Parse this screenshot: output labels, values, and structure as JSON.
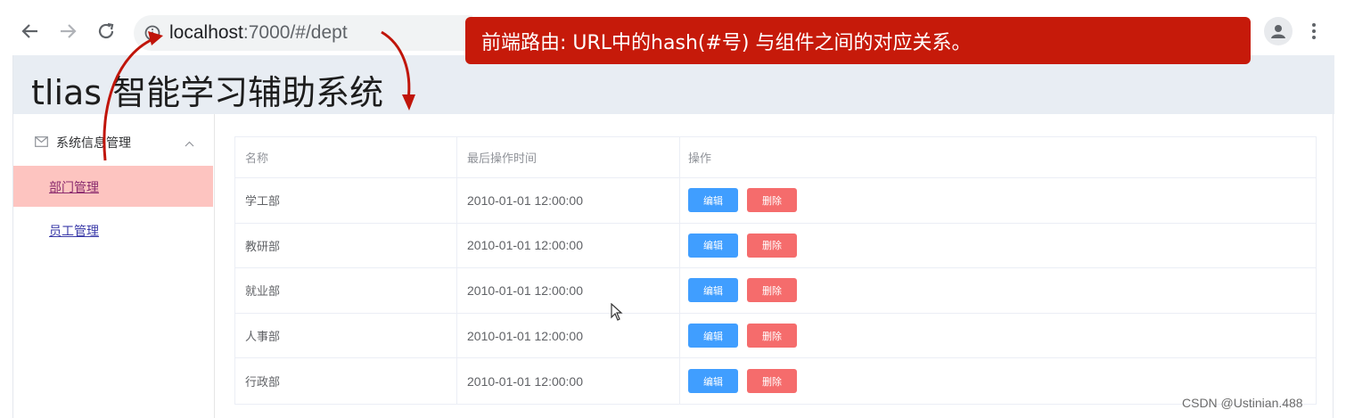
{
  "browser": {
    "url_host": "localhost",
    "url_rest": ":7000/#/dept",
    "icons": {
      "back": "back-arrow-icon",
      "forward": "forward-arrow-icon",
      "reload": "reload-icon",
      "info": "site-info-icon",
      "profile": "profile-icon",
      "menu": "more-menu-icon"
    }
  },
  "annotation": {
    "text": "前端路由: URL中的hash(#号) 与组件之间的对应关系。",
    "color": "#c61a0a"
  },
  "app": {
    "title": "tlias 智能学习辅助系统",
    "sidebar": {
      "group_label": "系统信息管理",
      "items": [
        {
          "label": "部门管理",
          "active": true
        },
        {
          "label": "员工管理",
          "active": false
        }
      ]
    },
    "table": {
      "columns": [
        "名称",
        "最后操作时间",
        "操作"
      ],
      "edit_label": "编辑",
      "delete_label": "删除",
      "rows": [
        {
          "name": "学工部",
          "time": "2010-01-01 12:00:00"
        },
        {
          "name": "教研部",
          "time": "2010-01-01 12:00:00"
        },
        {
          "name": "就业部",
          "time": "2010-01-01 12:00:00"
        },
        {
          "name": "人事部",
          "time": "2010-01-01 12:00:00"
        },
        {
          "name": "行政部",
          "time": "2010-01-01 12:00:00"
        }
      ]
    }
  },
  "watermark": "CSDN @Ustinian.488",
  "colors": {
    "primary": "#409eff",
    "danger": "#f56c6c",
    "active_menu_bg": "#fdc4c0",
    "header_bg": "#e8edf3"
  }
}
